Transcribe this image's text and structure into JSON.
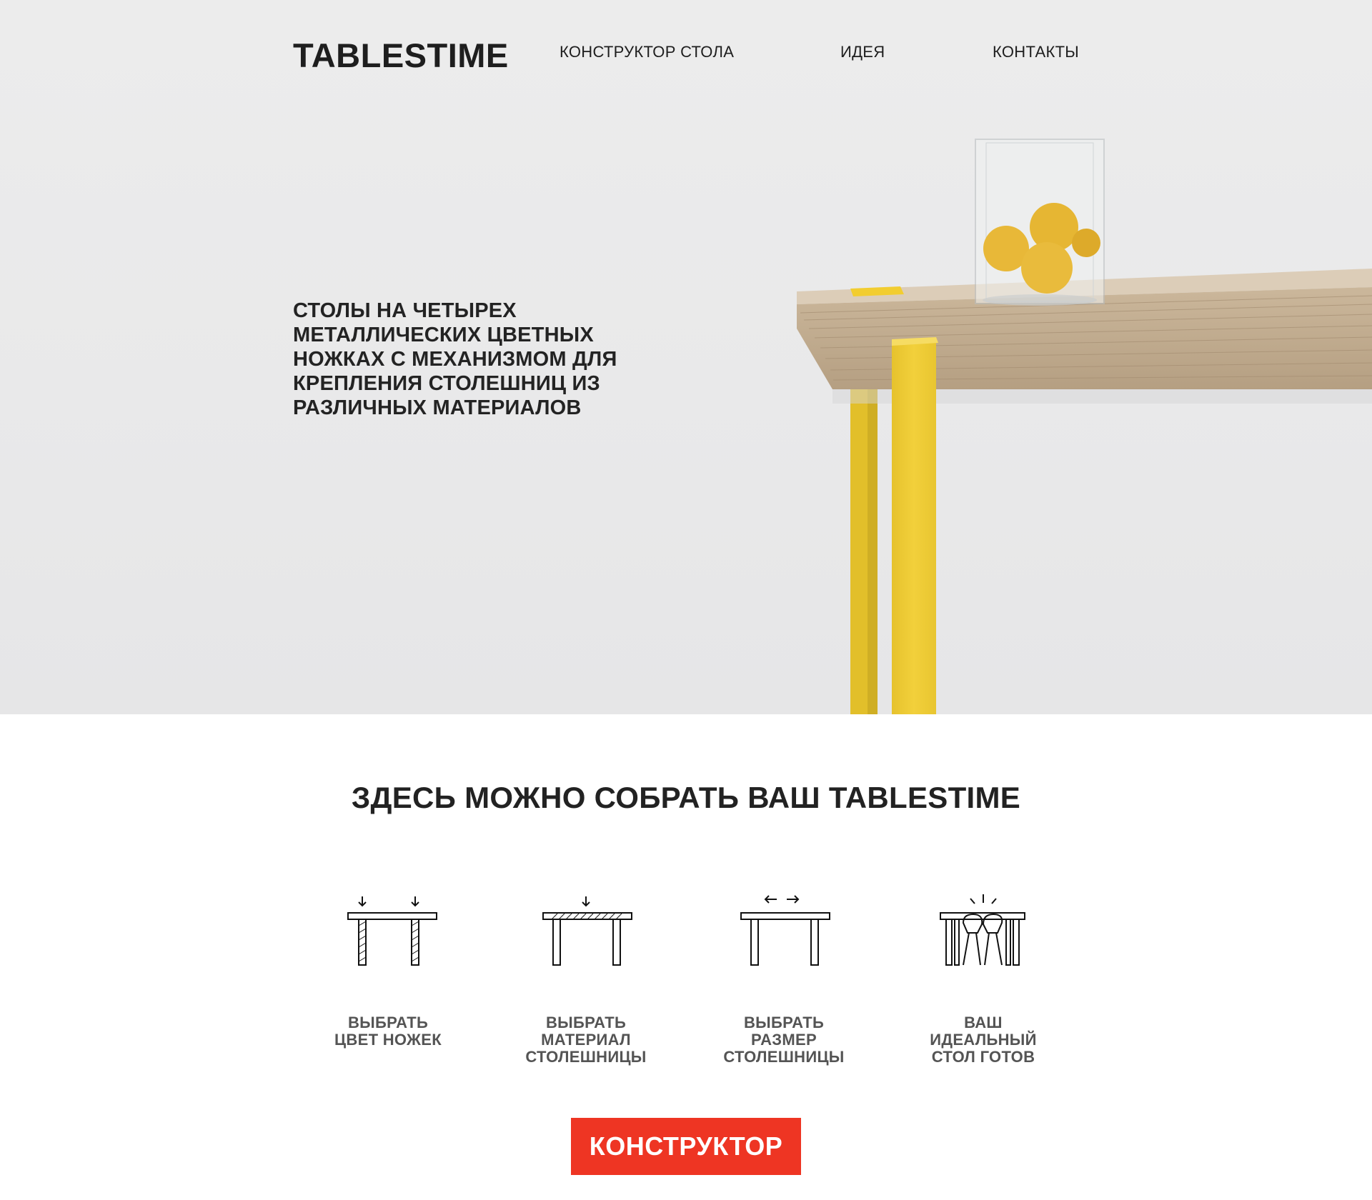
{
  "header": {
    "logo": "TABLESTIME",
    "nav": [
      "КОНСТРУКТОР СТОЛА",
      "ИДЕЯ",
      "КОНТАКТЫ"
    ]
  },
  "hero": {
    "tagline": [
      "СТОЛЫ НА ЧЕТЫРЕХ",
      "МЕТАЛЛИЧЕСКИХ ЦВЕТНЫХ",
      "НОЖКАХ С МЕХАНИЗМОМ ДЛЯ",
      "КРЕПЛЕНИЯ СТОЛЕШНИЦ ИЗ",
      "РАЗЛИЧНЫХ МАТЕРИАЛОВ"
    ],
    "photo_colors": {
      "leg": "#f0cd36",
      "tabletop": "#dccdb8",
      "lemon": "#e8b838"
    }
  },
  "section": {
    "title": "ЗДЕСЬ МОЖНО СОБРАТЬ ВАШ TABLESTIME",
    "steps": [
      {
        "icon": "table-legs-color-icon",
        "label": [
          "ВЫБРАТЬ",
          "ЦВЕТ НОЖЕК"
        ]
      },
      {
        "icon": "tabletop-material-icon",
        "label": [
          "ВЫБРАТЬ",
          "МАТЕРИАЛ",
          "СТОЛЕШНИЦЫ"
        ]
      },
      {
        "icon": "tabletop-size-icon",
        "label": [
          "ВЫБРАТЬ",
          "РАЗМЕР",
          "СТОЛЕШНИЦЫ"
        ]
      },
      {
        "icon": "table-ready-icon",
        "label": [
          "ВАШ",
          "ИДЕАЛЬНЫЙ",
          "СТОЛ ГОТОВ"
        ]
      }
    ]
  },
  "cta": {
    "label": "КОНСТРУКТОР",
    "color": "#ee3523"
  }
}
